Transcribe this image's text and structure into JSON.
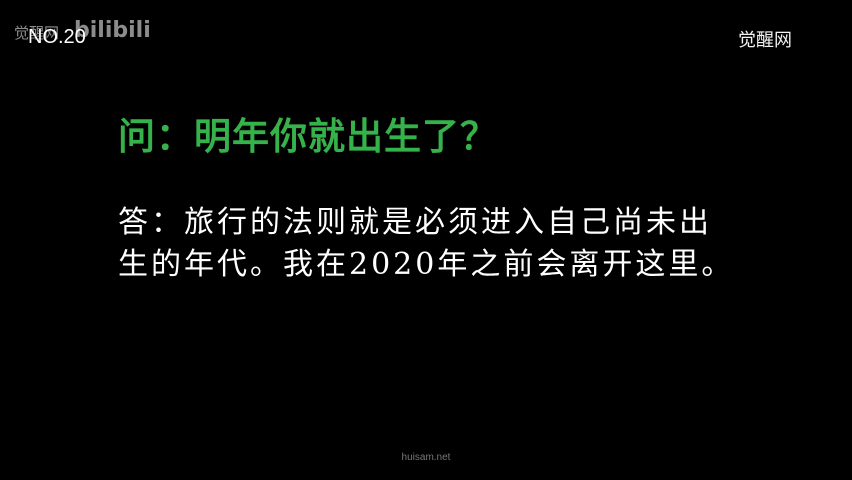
{
  "watermark": {
    "site_name_left": "觉醒网",
    "platform_logo": "bilibili",
    "site_name_right": "觉醒网",
    "footer_url": "huisam.net"
  },
  "episode": {
    "number_label": "NO.20"
  },
  "qa": {
    "question": "问：明年你就出生了？",
    "answer": "答：旅行的法则就是必须进入自己尚未出生的年代。我在2020年之前会离开这里。"
  },
  "colors": {
    "background": "#000000",
    "question_text": "#35b24a",
    "answer_text": "#ffffff"
  }
}
